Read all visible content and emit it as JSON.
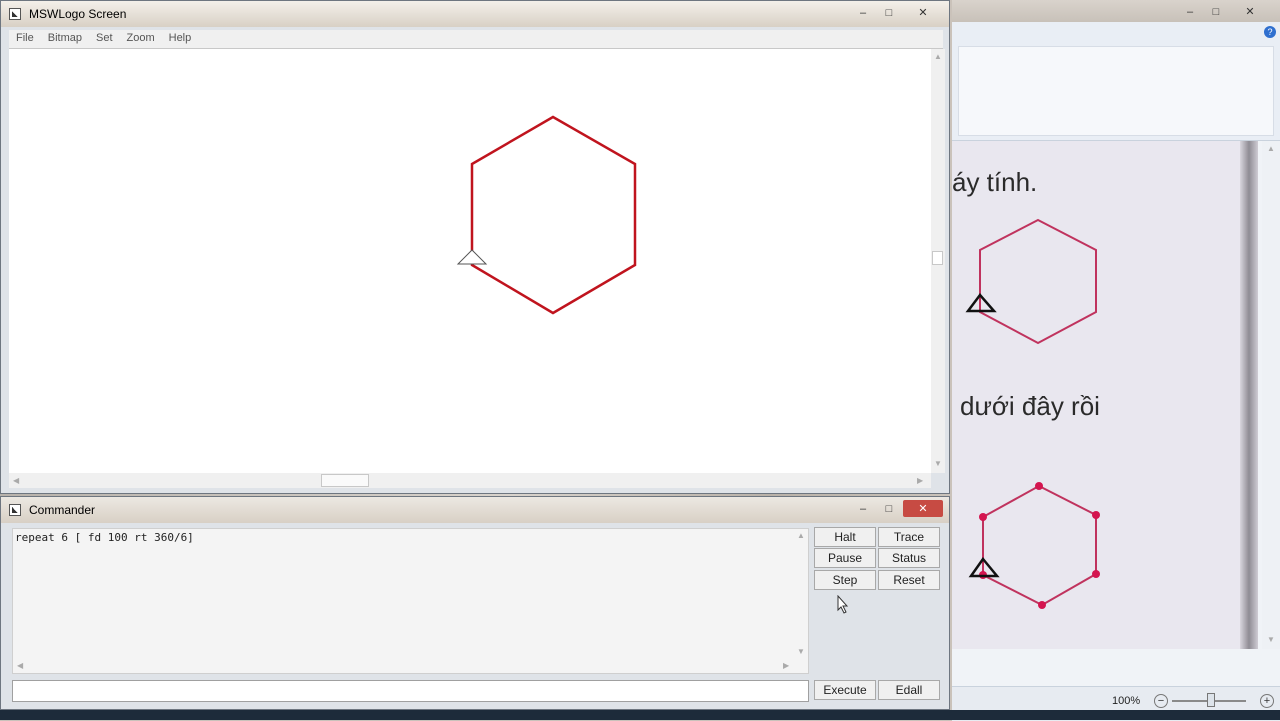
{
  "main_window": {
    "title": "MSWLogo Screen",
    "menu": [
      "File",
      "Bitmap",
      "Set",
      "Zoom",
      "Help"
    ],
    "drawing": {
      "shape": "hexagon",
      "stroke_color": "#c0141e",
      "turtle_icon": "triangle-turtle-icon"
    }
  },
  "commander": {
    "title": "Commander",
    "history": "repeat 6 [ fd 100 rt 360/6]",
    "input_value": "",
    "buttons": {
      "halt": "Halt",
      "trace": "Trace",
      "pause": "Pause",
      "status": "Status",
      "step": "Step",
      "reset": "Reset",
      "execute": "Execute",
      "edall": "Edall"
    }
  },
  "viewer": {
    "text_line1": "áy tính.",
    "text_line2": "dưới đây rồi",
    "zoom_level": "100%",
    "accent": "#2f6fcf"
  }
}
